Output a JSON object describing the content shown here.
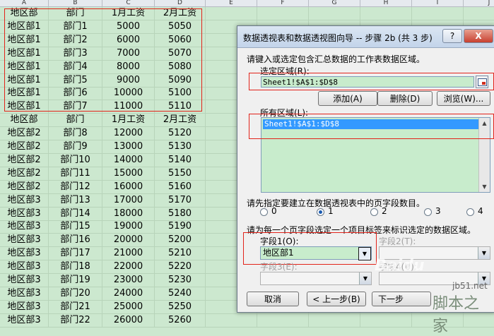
{
  "spreadsheet": {
    "column_letters": [
      "A",
      "B",
      "C",
      "D",
      "E",
      "F",
      "G",
      "H",
      "I",
      "J"
    ],
    "rows": [
      [
        "地区部",
        "部门",
        "1月工资",
        "2月工资"
      ],
      [
        "地区部1",
        "部门1",
        "5000",
        "5050"
      ],
      [
        "地区部1",
        "部门2",
        "6000",
        "5060"
      ],
      [
        "地区部1",
        "部门3",
        "7000",
        "5070"
      ],
      [
        "地区部1",
        "部门4",
        "8000",
        "5080"
      ],
      [
        "地区部1",
        "部门5",
        "9000",
        "5090"
      ],
      [
        "地区部1",
        "部门6",
        "10000",
        "5100"
      ],
      [
        "地区部1",
        "部门7",
        "11000",
        "5110"
      ],
      [
        "地区部",
        "部门",
        "1月工资",
        "2月工资"
      ],
      [
        "地区部2",
        "部门8",
        "12000",
        "5120"
      ],
      [
        "地区部2",
        "部门9",
        "13000",
        "5130"
      ],
      [
        "地区部2",
        "部门10",
        "14000",
        "5140"
      ],
      [
        "地区部2",
        "部门11",
        "15000",
        "5150"
      ],
      [
        "地区部2",
        "部门12",
        "16000",
        "5160"
      ],
      [
        "地区部3",
        "部门13",
        "17000",
        "5170"
      ],
      [
        "地区部3",
        "部门14",
        "18000",
        "5180"
      ],
      [
        "地区部3",
        "部门15",
        "19000",
        "5190"
      ],
      [
        "地区部3",
        "部门16",
        "20000",
        "5200"
      ],
      [
        "地区部3",
        "部门17",
        "21000",
        "5210"
      ],
      [
        "地区部3",
        "部门18",
        "22000",
        "5220"
      ],
      [
        "地区部3",
        "部门19",
        "23000",
        "5230"
      ],
      [
        "地区部3",
        "部门20",
        "24000",
        "5240"
      ],
      [
        "地区部3",
        "部门21",
        "25000",
        "5250"
      ],
      [
        "地区部3",
        "部门22",
        "26000",
        "5260"
      ]
    ]
  },
  "dialog": {
    "title": "数据透视表和数据透视图向导 -- 步骤 2b (共 3 步)",
    "help_button": "?",
    "close_button": "X",
    "instruction": "请键入或选定包含汇总数据的工作表数据区域。",
    "range_label": "选定区域(R):",
    "range_value": "Sheet1!$A$1:$D$8",
    "add_button": "添加(A)",
    "delete_button": "删除(D)",
    "browse_button": "浏览(W)...",
    "all_ranges_label": "所有区域(L):",
    "all_ranges_items": [
      "Sheet1!$A$1:$D$8"
    ],
    "page_field_prompt": "请先指定要建立在数据透视表中的页字段数目。",
    "page_field_options": [
      "0",
      "1",
      "2",
      "3",
      "4"
    ],
    "page_field_selected": "1",
    "label_prompt": "请为每一个页字段选定一个项目标签来标识选定的数据区域。",
    "field1_label": "字段1(O):",
    "field1_value": "地区部1",
    "field2_label": "字段2(T):",
    "field3_label": "字段3(E):",
    "field4_label": "字段4(U):",
    "cancel_button": "取消",
    "back_button": "< 上一步(B)",
    "next_button": "下一步"
  },
  "watermark": {
    "site": "jb51.net",
    "name": "脚本之家",
    "baidu": "Baidu"
  },
  "colors": {
    "grid_bg": "#cce8cf",
    "field_bg": "#c8eccc",
    "highlight_red": "#e2231a",
    "selection_blue": "#3399ff"
  }
}
